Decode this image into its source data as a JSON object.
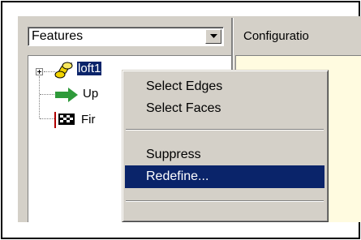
{
  "toolbar": {
    "features_dropdown_value": "Features",
    "configuration_tab_label": "Configuratio"
  },
  "tree": {
    "items": [
      {
        "label": "loft1",
        "icon": "loft-icon",
        "selected": true
      },
      {
        "label": "Up",
        "icon": "arrow-right-icon"
      },
      {
        "label": "Fir",
        "icon": "checkered-flag-icon"
      }
    ]
  },
  "context_menu": {
    "items": [
      {
        "label": "Select Edges"
      },
      {
        "label": "Select Faces"
      },
      {
        "label": "Suppress"
      },
      {
        "label": "Redefine...",
        "highlighted": true
      }
    ]
  },
  "colors": {
    "selection": "#0a246a",
    "panel": "#d4d0c8",
    "arrow_green": "#2e9a3a",
    "loft_yellow": "#f2d400"
  }
}
